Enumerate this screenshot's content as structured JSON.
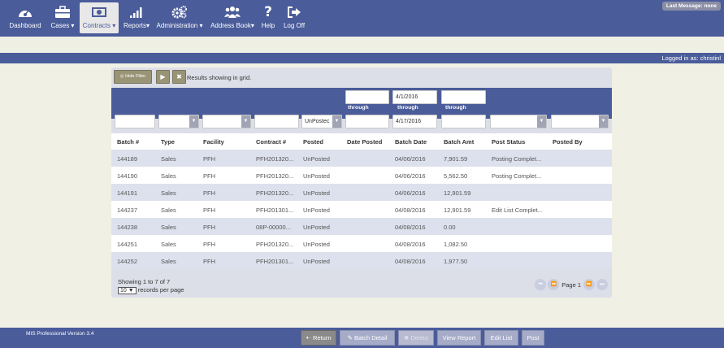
{
  "nav": {
    "items": [
      {
        "label": "Dashboard",
        "icon": "dashboard-icon"
      },
      {
        "label": "Cases ▾",
        "icon": "briefcase-icon"
      },
      {
        "label": "Contracts ▾",
        "icon": "money-icon"
      },
      {
        "label": "Reports▾",
        "icon": "bar-chart-icon"
      },
      {
        "label": "Administration ▾",
        "icon": "gears-icon"
      },
      {
        "label": "Address Book▾",
        "icon": "users-icon"
      },
      {
        "label": "Help",
        "icon": "question-icon"
      },
      {
        "label": "Log Off",
        "icon": "sign-out-icon"
      }
    ],
    "last_message": "Last Message: none"
  },
  "user": {
    "logged_in": "Logged in as: christinl"
  },
  "toolbar": {
    "hide_filter": "◎ Hide Filter",
    "play": "▶",
    "clear": "✖",
    "results_text": "Results showing in grid."
  },
  "filters": {
    "posted_value": "UnPostec",
    "batch_date_from": "4/1/2016",
    "batch_date_to": "4/17/2016",
    "through_label": "through"
  },
  "table": {
    "headers": [
      "Batch #",
      "Type",
      "Facility",
      "Contract #",
      "Posted",
      "Date Posted",
      "Batch Date",
      "Batch Amt",
      "Post Status",
      "Posted By"
    ],
    "rows": [
      [
        "144189",
        "Sales",
        "PFH",
        "PFH201320...",
        "UnPosted",
        "",
        "04/06/2016",
        "7,901.59",
        "Posting Complet...",
        ""
      ],
      [
        "144190",
        "Sales",
        "PFH",
        "PFH201320...",
        "UnPosted",
        "",
        "04/06/2016",
        "5,562.50",
        "Posting Complet...",
        ""
      ],
      [
        "144191",
        "Sales",
        "PFH",
        "PFH201320...",
        "UnPosted",
        "",
        "04/06/2016",
        "12,901.59",
        "",
        ""
      ],
      [
        "144237",
        "Sales",
        "PFH",
        "PFH201301...",
        "UnPosted",
        "",
        "04/08/2016",
        "12,901.59",
        "Edit List Complet...",
        ""
      ],
      [
        "144238",
        "Sales",
        "PFH",
        "08P-00000...",
        "UnPosted",
        "",
        "04/08/2016",
        "0.00",
        "",
        ""
      ],
      [
        "144251",
        "Sales",
        "PFH",
        "PFH201320...",
        "UnPosted",
        "",
        "04/08/2016",
        "1,082.50",
        "",
        ""
      ],
      [
        "144252",
        "Sales",
        "PFH",
        "PFH201301...",
        "UnPosted",
        "",
        "04/08/2016",
        "1,977.50",
        "",
        ""
      ]
    ]
  },
  "pagination": {
    "showing": "Showing 1 to 7 of 7",
    "records_per_page_value": "10",
    "records_per_page_label": "records per page",
    "page_label": "Page 1"
  },
  "footer": {
    "version": "MIS Professional Version 3.4",
    "buttons": {
      "return": "🠠 Return",
      "batch_detail": "✎ Batch Detail",
      "delete": "✖ Delete",
      "view_report": "View Report",
      "edit_list": "Edit List",
      "post": "Post"
    }
  },
  "colors": {
    "brand": "#4a5c9a",
    "filter_button": "#9a9476",
    "row_alt": "#dde1ed"
  }
}
